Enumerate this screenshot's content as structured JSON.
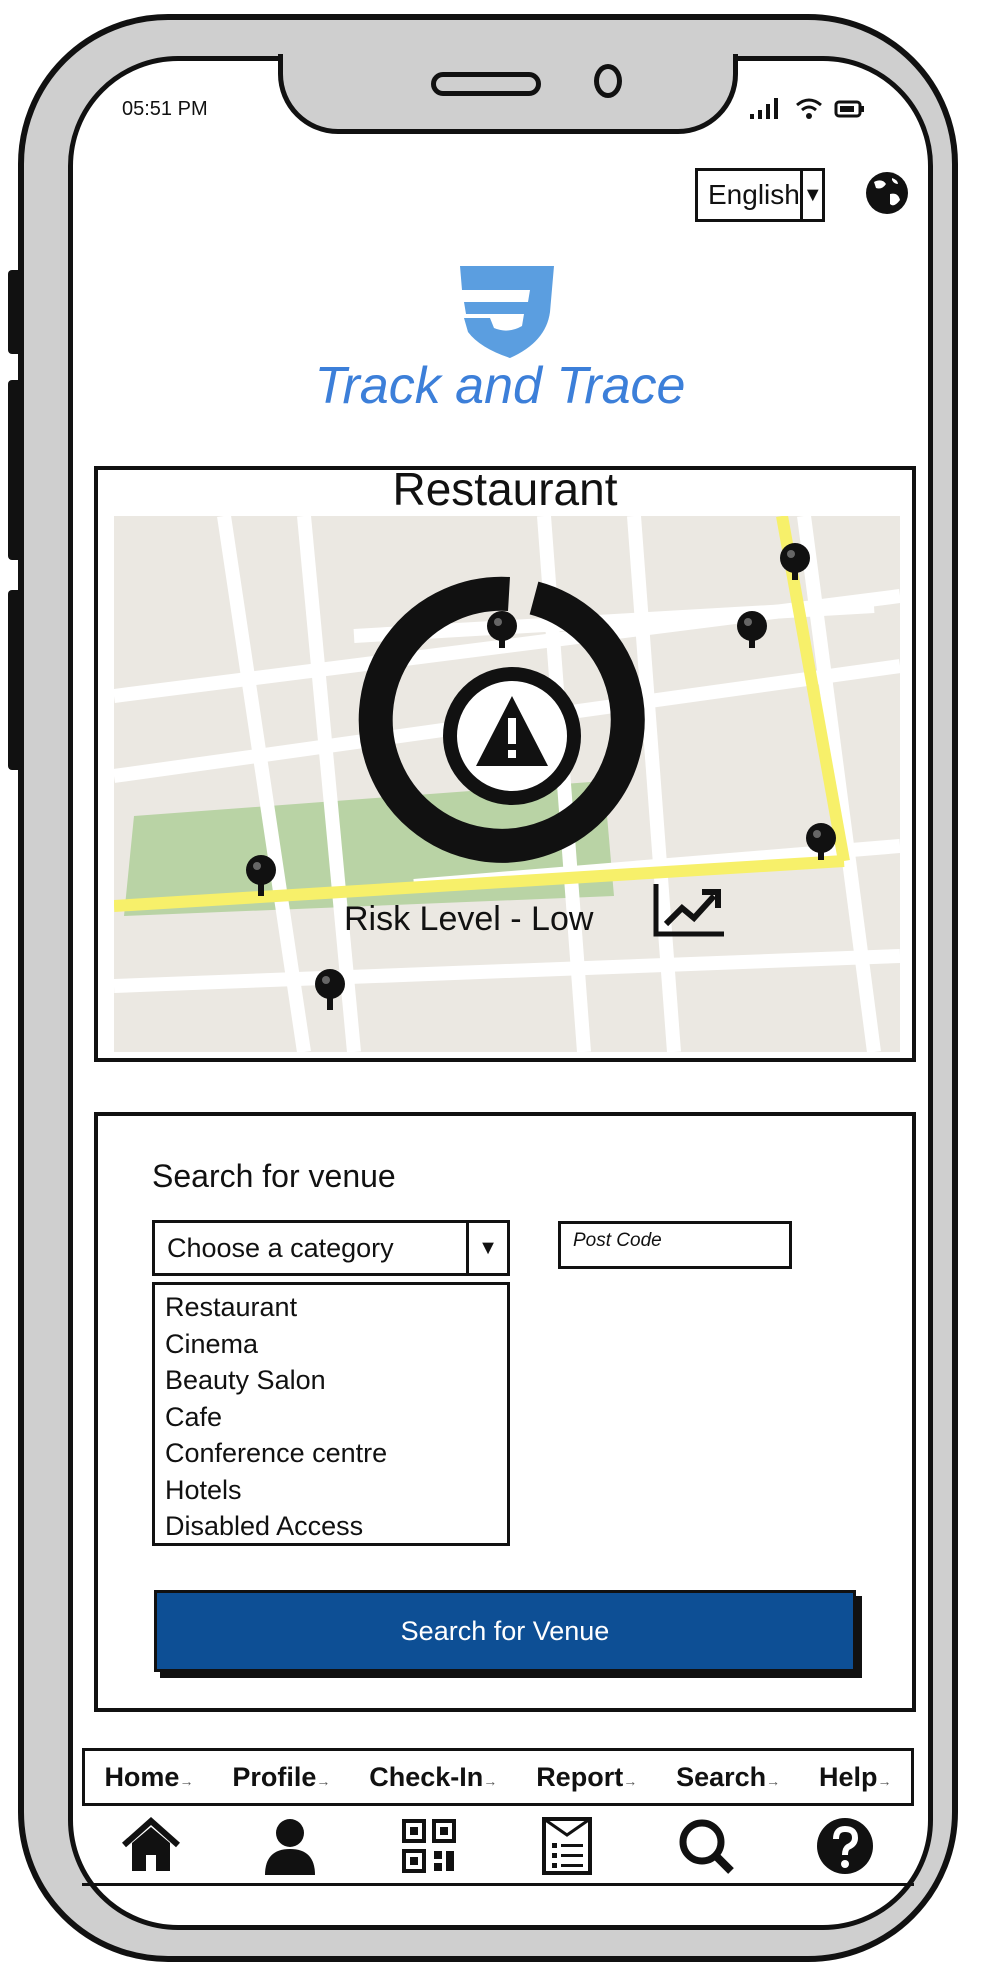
{
  "status_bar": {
    "time": "05:51 PM"
  },
  "language": {
    "selected": "English"
  },
  "brand": {
    "name": "Track and Trace"
  },
  "venue_card": {
    "title": "Restaurant",
    "risk_text": "Risk Level - Low"
  },
  "search": {
    "heading": "Search for venue",
    "category_value": "Choose a category",
    "postcode_placeholder": "Post Code",
    "options": [
      "Restaurant",
      "Cinema",
      "Beauty Salon",
      "Cafe",
      "Conference centre",
      "Hotels",
      "Disabled Access"
    ],
    "button_label": "Search for Venue"
  },
  "nav": {
    "items": [
      {
        "label": "Home",
        "icon": "home-icon"
      },
      {
        "label": "Profile",
        "icon": "user-icon"
      },
      {
        "label": "Check-In",
        "icon": "qr-code-icon"
      },
      {
        "label": "Report",
        "icon": "report-icon"
      },
      {
        "label": "Search",
        "icon": "search-icon"
      },
      {
        "label": "Help",
        "icon": "help-icon"
      }
    ]
  },
  "colors": {
    "brand": "#3c7fd9",
    "button": "#0d4f95",
    "road_highlight": "#f7f06a",
    "park": "#b9d3a5"
  }
}
